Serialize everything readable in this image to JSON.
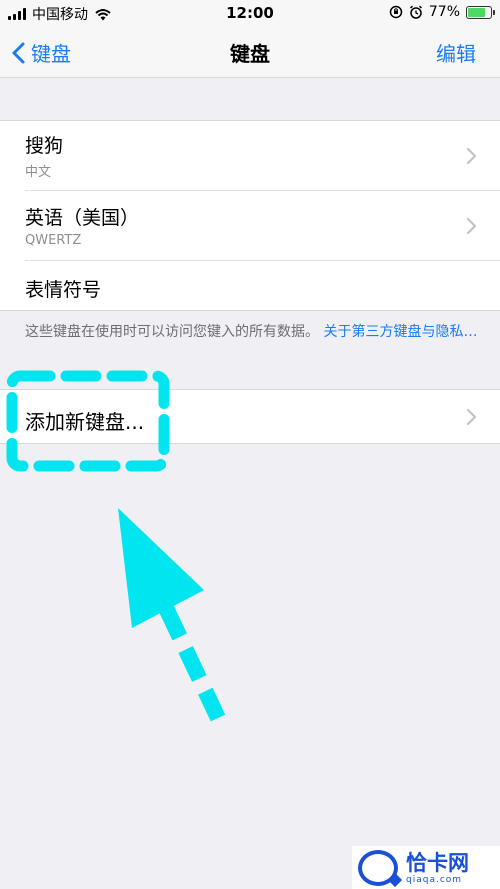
{
  "status_bar": {
    "carrier": "中国移动",
    "time": "12:00",
    "battery_percent": "77%",
    "battery_level": 0.77
  },
  "nav": {
    "back_label": "键盘",
    "title": "键盘",
    "edit_label": "编辑"
  },
  "keyboards": [
    {
      "title": "搜狗",
      "subtitle": "中文"
    },
    {
      "title": "英语（美国）",
      "subtitle": "QWERTZ"
    },
    {
      "title": "表情符号"
    }
  ],
  "footer": {
    "text": "这些键盘在使用时可以访问您键入的所有数据。",
    "link": "关于第三方键盘与隐私…"
  },
  "add_keyboard": {
    "label": "添加新键盘..."
  },
  "watermark": {
    "main": "恰卡网",
    "sub": "qiaqa.com"
  },
  "colors": {
    "accent": "#1a7cf5",
    "annotation": "#00e5ef",
    "background": "#efeff4"
  }
}
